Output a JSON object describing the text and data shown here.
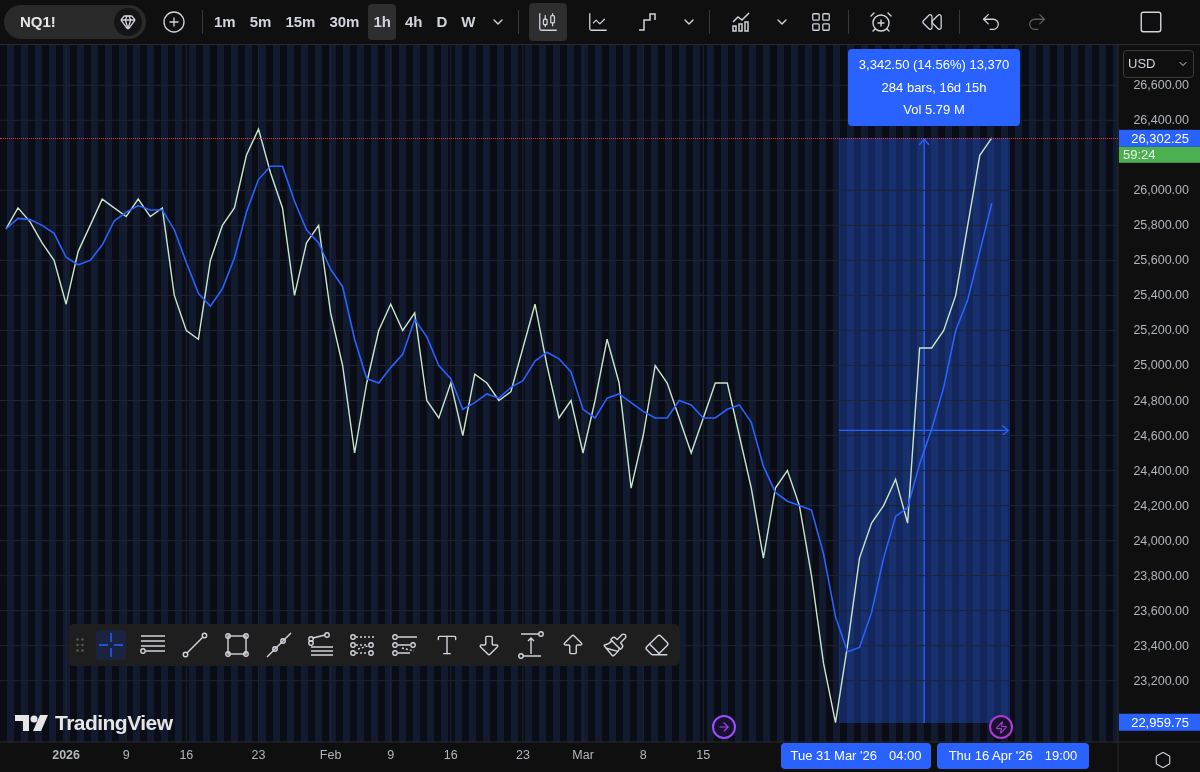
{
  "symbol": "NQ1!",
  "intervals": [
    {
      "label": "1m",
      "selected": false
    },
    {
      "label": "5m",
      "selected": false
    },
    {
      "label": "15m",
      "selected": false
    },
    {
      "label": "30m",
      "selected": false
    },
    {
      "label": "1h",
      "selected": true
    },
    {
      "label": "4h",
      "selected": false
    },
    {
      "label": "D",
      "selected": false
    },
    {
      "label": "W",
      "selected": false
    }
  ],
  "chart_types": [
    {
      "kind": "candles",
      "selected": true
    },
    {
      "kind": "line",
      "selected": false
    },
    {
      "kind": "step",
      "selected": false
    }
  ],
  "undo": {
    "disabled": false
  },
  "redo": {
    "disabled": true
  },
  "currency": "USD",
  "price_labels": {
    "last_price": "26,302.25",
    "countdown": "59:24",
    "low": "22,959.75"
  },
  "measure": {
    "lines": [
      "3,342.50 (14.56%) 13,370",
      "284 bars, 16d 15h",
      "Vol 5.79 M"
    ],
    "start": {
      "date": "Tue 31 Mar '26",
      "time": "04:00"
    },
    "end": {
      "date": "Thu 16 Apr '26",
      "time": "19:00"
    }
  },
  "drawing_tools": [
    {
      "kind": "crosshair",
      "selected": true
    },
    {
      "kind": "hlines",
      "selected": false
    },
    {
      "kind": "trendline",
      "selected": false
    },
    {
      "kind": "rectangle",
      "selected": false
    },
    {
      "kind": "ray",
      "selected": false
    },
    {
      "kind": "fib",
      "selected": false
    },
    {
      "kind": "channel",
      "selected": false
    },
    {
      "kind": "regression",
      "selected": false
    },
    {
      "kind": "text",
      "selected": false
    },
    {
      "kind": "arrowdown",
      "selected": false
    },
    {
      "kind": "measure",
      "selected": false
    },
    {
      "kind": "arrowup",
      "selected": false
    },
    {
      "kind": "brush",
      "selected": false
    },
    {
      "kind": "eraser",
      "selected": false
    }
  ],
  "logo": "TradingView",
  "chart_data": {
    "type": "line",
    "grid": true,
    "ylim": [
      22850,
      26830
    ],
    "categories": [
      null,
      null,
      null,
      null,
      null,
      "2026",
      null,
      null,
      null,
      null,
      "9",
      null,
      null,
      null,
      null,
      "16",
      null,
      null,
      null,
      null,
      null,
      "23",
      null,
      null,
      null,
      null,
      null,
      "Feb",
      null,
      null,
      null,
      null,
      "9",
      null,
      null,
      null,
      null,
      "16",
      null,
      null,
      null,
      null,
      null,
      "23",
      null,
      null,
      null,
      null,
      "Mar",
      null,
      null,
      null,
      null,
      "8",
      null,
      null,
      null,
      null,
      "15",
      null,
      null,
      null,
      null,
      null,
      null,
      null,
      null,
      null,
      null,
      null,
      null,
      null,
      null,
      null,
      null,
      null,
      null,
      null,
      null,
      null,
      null,
      null,
      null,
      null,
      null,
      null,
      null,
      null,
      null,
      null,
      null,
      null,
      null
    ],
    "yticks": [
      {
        "value": 23200,
        "label": "23,200.00"
      },
      {
        "value": 23400,
        "label": "23,400.00"
      },
      {
        "value": 23600,
        "label": "23,600.00"
      },
      {
        "value": 23800,
        "label": "23,800.00"
      },
      {
        "value": 24000,
        "label": "24,000.00"
      },
      {
        "value": 24200,
        "label": "24,200.00"
      },
      {
        "value": 24400,
        "label": "24,400.00"
      },
      {
        "value": 24600,
        "label": "24,600.00"
      },
      {
        "value": 24800,
        "label": "24,800.00"
      },
      {
        "value": 25000,
        "label": "25,000.00"
      },
      {
        "value": 25200,
        "label": "25,200.00"
      },
      {
        "value": 25400,
        "label": "25,400.00"
      },
      {
        "value": 25600,
        "label": "25,600.00"
      },
      {
        "value": 25800,
        "label": "25,800.00"
      },
      {
        "value": 26000,
        "label": "26,000.00"
      },
      {
        "value": 26400,
        "label": "26,400.00"
      },
      {
        "value": 26600,
        "label": "26,600.00"
      }
    ],
    "series": [
      {
        "color": "#c8e6c9",
        "values": [
          25780,
          25900,
          25820,
          25700,
          25600,
          25350,
          25650,
          25800,
          25950,
          25900,
          25850,
          25950,
          25850,
          25900,
          25400,
          25200,
          25150,
          25600,
          25800,
          25900,
          26200,
          26350,
          26100,
          25900,
          25400,
          25700,
          25800,
          25300,
          25000,
          24500,
          24900,
          25200,
          25350,
          25200,
          25300,
          24800,
          24700,
          24900,
          24600,
          24950,
          24900,
          24800,
          24850,
          25100,
          25350,
          25000,
          24700,
          24800,
          24500,
          24800,
          25150,
          24900,
          24300,
          24600,
          25000,
          24900,
          24700,
          24500,
          24700,
          24900,
          24900,
          24600,
          24300,
          23900,
          24300,
          24400,
          24200,
          23800,
          23300,
          22960,
          23400,
          23900,
          24100,
          24200,
          24350,
          24100,
          25100,
          25100,
          25200,
          25400,
          25800,
          26200,
          26300,
          null,
          null,
          null,
          null,
          null,
          null,
          null,
          null,
          null,
          null
        ]
      },
      {
        "color": "#2962ff",
        "values": [
          25780,
          25840,
          25833,
          25800,
          25755,
          25618,
          25575,
          25600,
          25688,
          25825,
          25875,
          25913,
          25888,
          25888,
          25775,
          25588,
          25413,
          25338,
          25438,
          25613,
          25875,
          26063,
          26138,
          26138,
          25938,
          25775,
          25700,
          25550,
          25450,
          25150,
          24925,
          24900,
          24988,
          25063,
          25263,
          25163,
          25000,
          24925,
          24750,
          24788,
          24838,
          24813,
          24875,
          24913,
          25025,
          25075,
          25038,
          24963,
          24750,
          24700,
          24813,
          24838,
          24788,
          24738,
          24700,
          24700,
          24800,
          24775,
          24700,
          24700,
          24750,
          24775,
          24675,
          24425,
          24275,
          24225,
          24200,
          24175,
          23925,
          23565,
          23365,
          23390,
          23590,
          23900,
          24138,
          24188,
          24438,
          24638,
          24875,
          25200,
          25375,
          25650,
          25926,
          null,
          null,
          null,
          null,
          null,
          null,
          null,
          null,
          null,
          null
        ]
      }
    ]
  }
}
